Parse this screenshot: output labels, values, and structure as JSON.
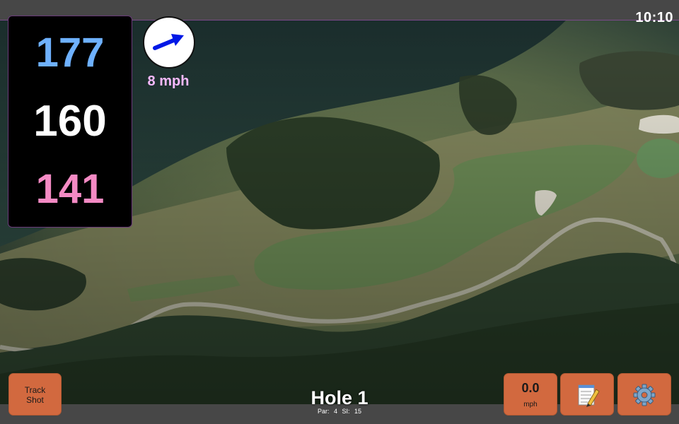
{
  "status": {
    "time": "10:10"
  },
  "distances": {
    "back": "177",
    "middle": "160",
    "front": "141"
  },
  "wind": {
    "speed": "8 mph",
    "icon": "wind-arrow-icon"
  },
  "hole": {
    "title": "Hole 1",
    "par": "Par: 4",
    "stroke_index": "SI: 15"
  },
  "buttons": {
    "track_shot_line1": "Track",
    "track_shot_line2": "Shot",
    "speed_value": "0.0",
    "speed_unit": "mph",
    "notes_icon": "notepad-icon",
    "settings_icon": "gear-icon"
  },
  "colors": {
    "back": "#6eb1ff",
    "middle": "#ffffff",
    "front": "#f48ac4",
    "wind_text": "#f7b9ff",
    "button": "#d2693f"
  }
}
